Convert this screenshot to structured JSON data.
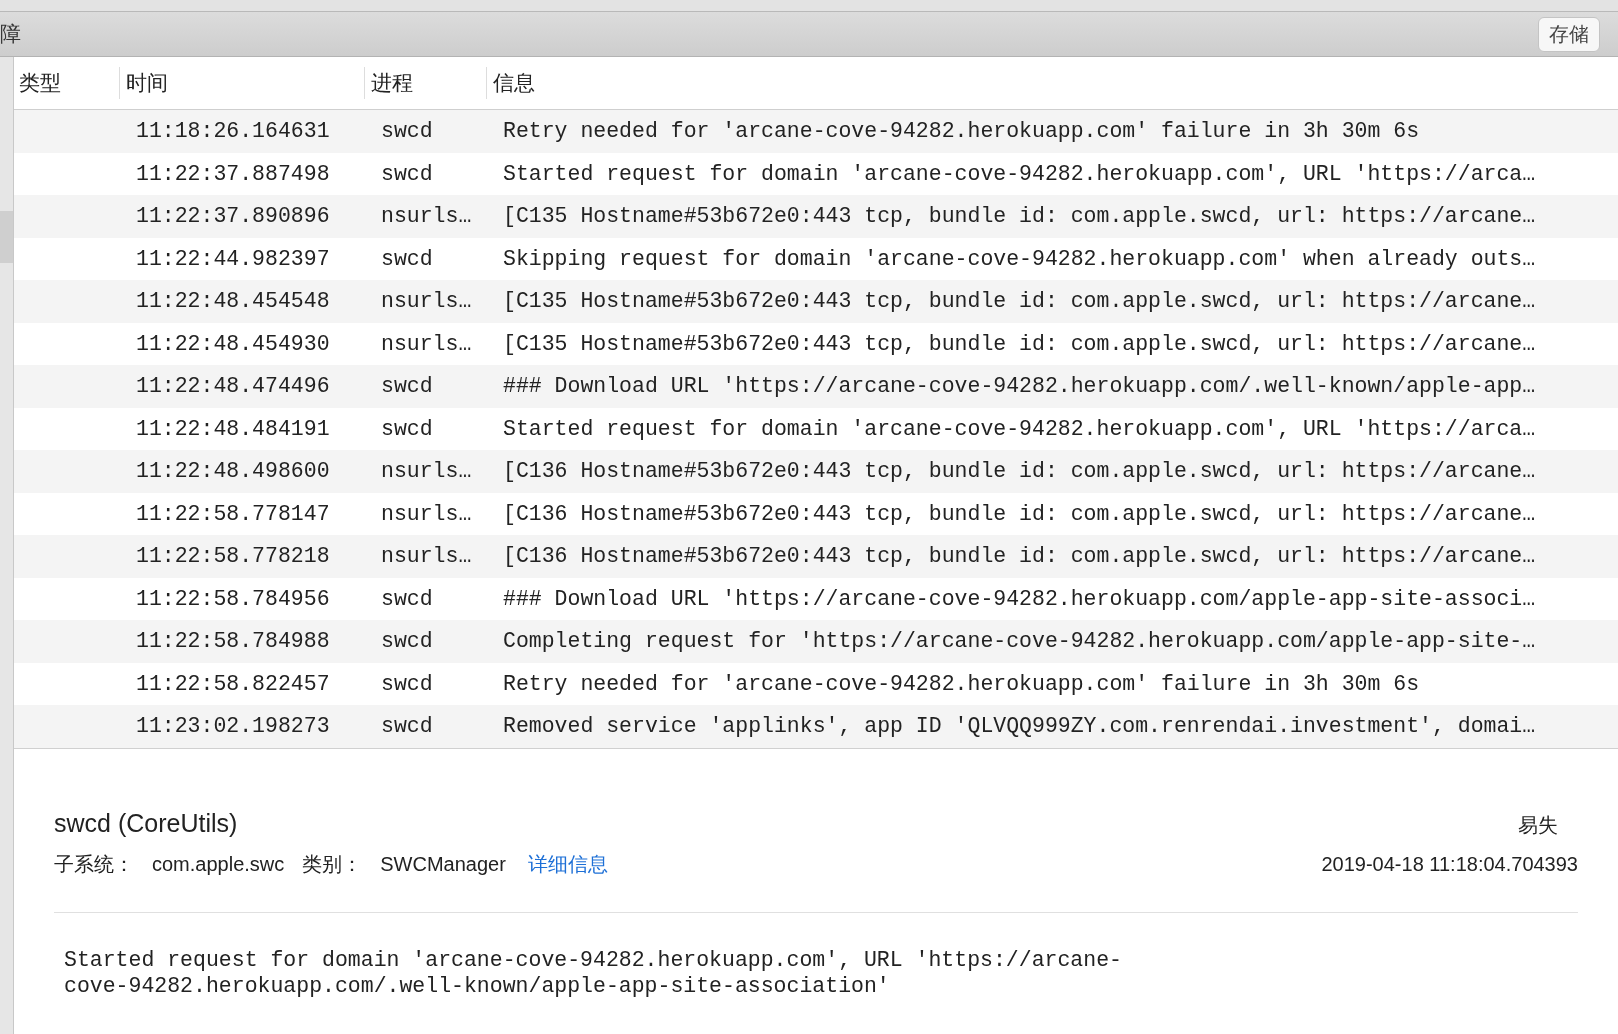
{
  "toolbar": {
    "title_fragment": "障",
    "save_button": "存储"
  },
  "table": {
    "columns": [
      "类型",
      "时间",
      "进程",
      "信息"
    ],
    "rows": [
      {
        "time": "11:18:26.164631",
        "process": "swcd",
        "message": "Retry needed for 'arcane-cove-94282.herokuapp.com' failure in 3h 30m 6s"
      },
      {
        "time": "11:22:37.887498",
        "process": "swcd",
        "message": "Started request for domain 'arcane-cove-94282.herokuapp.com', URL 'https://arca…"
      },
      {
        "time": "11:22:37.890896",
        "process": "nsurls…",
        "message": "[C135 Hostname#53b672e0:443 tcp, bundle id: com.apple.swcd, url: https://arcane…"
      },
      {
        "time": "11:22:44.982397",
        "process": "swcd",
        "message": "Skipping request for domain 'arcane-cove-94282.herokuapp.com' when already outs…"
      },
      {
        "time": "11:22:48.454548",
        "process": "nsurls…",
        "message": "[C135 Hostname#53b672e0:443 tcp, bundle id: com.apple.swcd, url: https://arcane…"
      },
      {
        "time": "11:22:48.454930",
        "process": "nsurls…",
        "message": "[C135 Hostname#53b672e0:443 tcp, bundle id: com.apple.swcd, url: https://arcane…"
      },
      {
        "time": "11:22:48.474496",
        "process": "swcd",
        "message": "### Download URL 'https://arcane-cove-94282.herokuapp.com/.well-known/apple-app…"
      },
      {
        "time": "11:22:48.484191",
        "process": "swcd",
        "message": "Started request for domain 'arcane-cove-94282.herokuapp.com', URL 'https://arca…"
      },
      {
        "time": "11:22:48.498600",
        "process": "nsurls…",
        "message": "[C136 Hostname#53b672e0:443 tcp, bundle id: com.apple.swcd, url: https://arcane…"
      },
      {
        "time": "11:22:58.778147",
        "process": "nsurls…",
        "message": "[C136 Hostname#53b672e0:443 tcp, bundle id: com.apple.swcd, url: https://arcane…"
      },
      {
        "time": "11:22:58.778218",
        "process": "nsurls…",
        "message": "[C136 Hostname#53b672e0:443 tcp, bundle id: com.apple.swcd, url: https://arcane…"
      },
      {
        "time": "11:22:58.784956",
        "process": "swcd",
        "message": "### Download URL 'https://arcane-cove-94282.herokuapp.com/apple-app-site-associ…"
      },
      {
        "time": "11:22:58.784988",
        "process": "swcd",
        "message": "Completing request for 'https://arcane-cove-94282.herokuapp.com/apple-app-site-…"
      },
      {
        "time": "11:22:58.822457",
        "process": "swcd",
        "message": "Retry needed for 'arcane-cove-94282.herokuapp.com' failure in 3h 30m 6s"
      },
      {
        "time": "11:23:02.198273",
        "process": "swcd",
        "message": "Removed service 'applinks', app ID 'QLVQQ999ZY.com.renrendai.investment', domai…"
      }
    ]
  },
  "detail": {
    "process": "swcd (CoreUtils)",
    "volatility": "易失",
    "subsystem_label": "子系统：",
    "subsystem": "com.apple.swc",
    "category_label": "类别：",
    "category": "SWCManager",
    "details_link": "详细信息",
    "timestamp": "2019-04-18 11:18:04.704393",
    "message": "Started request for domain 'arcane-cove-94282.herokuapp.com', URL 'https://arcane-cove-94282.herokuapp.com/.well-known/apple-app-site-association'"
  }
}
